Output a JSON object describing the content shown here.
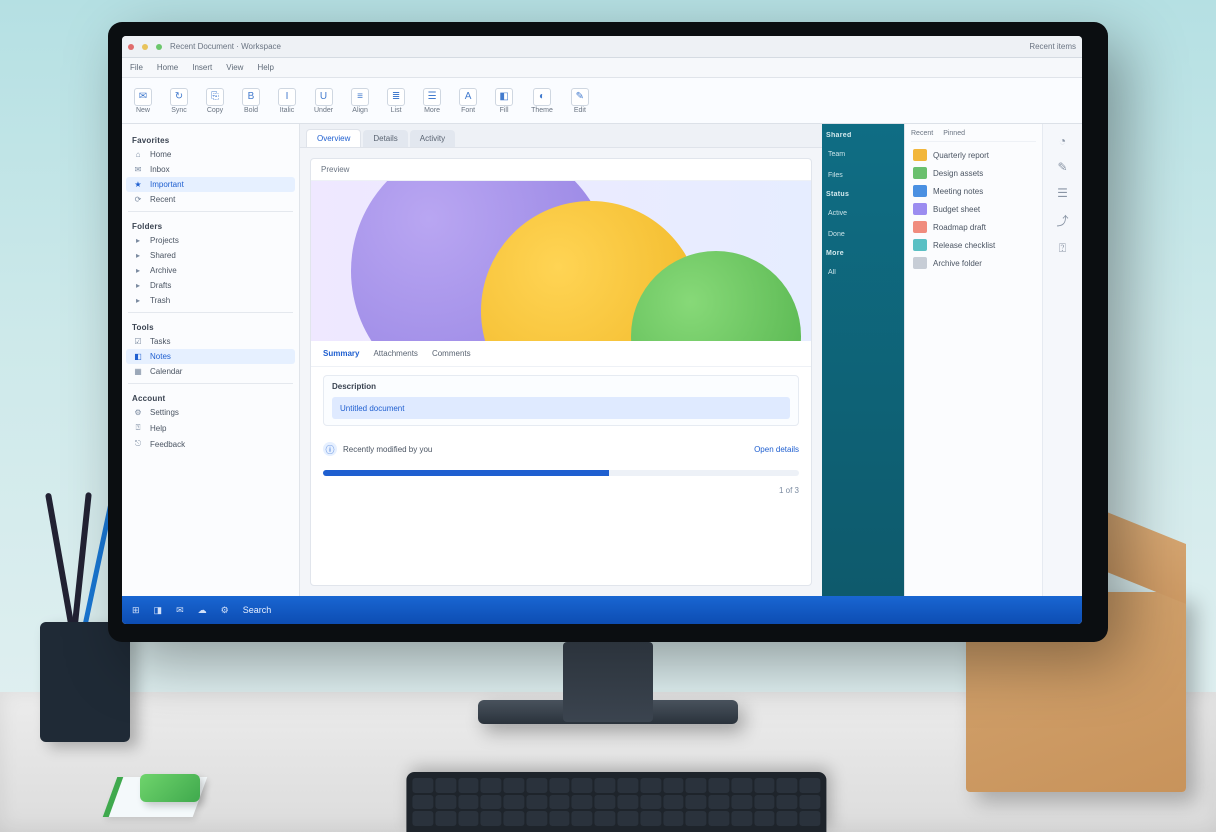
{
  "window": {
    "title": "Recent Document · Workspace",
    "subtitle": "Recent items"
  },
  "menubar": [
    "File",
    "Home",
    "Insert",
    "View",
    "Help"
  ],
  "ribbon": [
    {
      "icon": "✉",
      "label": "New"
    },
    {
      "icon": "↻",
      "label": "Sync"
    },
    {
      "icon": "⎘",
      "label": "Copy"
    },
    {
      "icon": "B",
      "label": "Bold"
    },
    {
      "icon": "I",
      "label": "Italic"
    },
    {
      "icon": "U",
      "label": "Under"
    },
    {
      "icon": "≡",
      "label": "Align"
    },
    {
      "icon": "≣",
      "label": "List"
    },
    {
      "icon": "☰",
      "label": "More"
    },
    {
      "icon": "A",
      "label": "Font"
    },
    {
      "icon": "◧",
      "label": "Fill"
    },
    {
      "icon": "◐",
      "label": "Theme"
    },
    {
      "icon": "✎",
      "label": "Edit"
    }
  ],
  "sidebar": {
    "section1": "Favorites",
    "items1": [
      {
        "g": "⌂",
        "t": "Home"
      },
      {
        "g": "✉",
        "t": "Inbox"
      },
      {
        "g": "★",
        "t": "Important",
        "sel": true
      },
      {
        "g": "⟳",
        "t": "Recent"
      }
    ],
    "section2": "Folders",
    "items2": [
      {
        "g": "▸",
        "t": "Projects"
      },
      {
        "g": "▸",
        "t": "Shared"
      },
      {
        "g": "▸",
        "t": "Archive"
      },
      {
        "g": "▸",
        "t": "Drafts"
      },
      {
        "g": "▸",
        "t": "Trash"
      }
    ],
    "section3": "Tools",
    "items3": [
      {
        "g": "☑",
        "t": "Tasks"
      },
      {
        "g": "◧",
        "t": "Notes",
        "sel": true
      },
      {
        "g": "▦",
        "t": "Calendar"
      }
    ],
    "section4": "Account",
    "items4": [
      {
        "g": "⚙",
        "t": "Settings"
      },
      {
        "g": "⍰",
        "t": "Help"
      },
      {
        "g": "⎋",
        "t": "Feedback"
      }
    ]
  },
  "center": {
    "tabs": [
      "Overview",
      "Details",
      "Activity"
    ],
    "docTitle": "Preview",
    "subtabs": [
      "Summary",
      "Attachments",
      "Comments"
    ],
    "panelTitle": "Description",
    "fieldValue": "Untitled document",
    "infoText": "Recently modified by you",
    "linkText": "Open details",
    "footer": "1 of 3"
  },
  "railTeal": {
    "h1": "Shared",
    "i1": "Team",
    "i2": "Files",
    "h2": "Status",
    "i3": "Active",
    "i4": "Done",
    "h3": "More",
    "i5": "All"
  },
  "railRight": {
    "tabs": [
      "Recent",
      "Pinned"
    ],
    "cards": [
      {
        "c": "#f2b63a",
        "t": "Quarterly report"
      },
      {
        "c": "#6ac06e",
        "t": "Design assets"
      },
      {
        "c": "#4a90e2",
        "t": "Meeting notes"
      },
      {
        "c": "#9b8cf0",
        "t": "Budget sheet"
      },
      {
        "c": "#f08c7e",
        "t": "Roadmap draft"
      },
      {
        "c": "#5ac0c4",
        "t": "Release checklist"
      },
      {
        "c": "#c7cdd6",
        "t": "Archive folder"
      }
    ]
  },
  "thinRail": [
    "◔",
    "✎",
    "☰",
    "⤴",
    "⍰"
  ],
  "taskbar": {
    "items": [
      "⊞",
      "◨",
      "✉",
      "☁",
      "⚙"
    ],
    "label": "Search"
  }
}
